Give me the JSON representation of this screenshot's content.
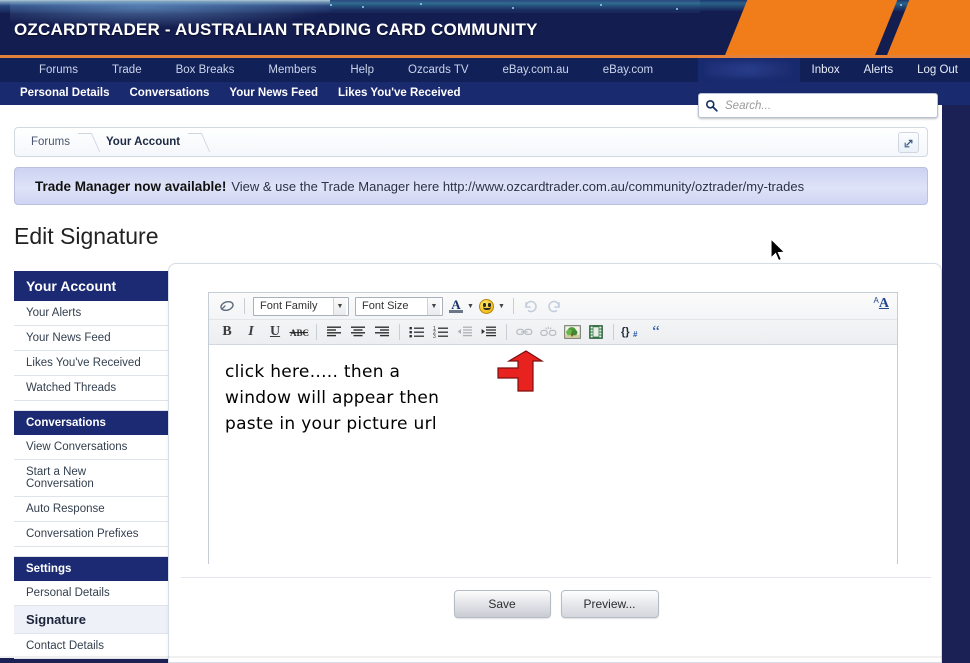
{
  "banner": {
    "title": "OZCARDTRADER - AUSTRALIAN TRADING CARD COMMUNITY"
  },
  "colors": {
    "banner_bg": "#141d4f",
    "accent_orange": "#f07d1a",
    "nav_bg": "#122058",
    "subnav_bg": "#1a2a6f",
    "sidebar_head": "#1b2a72",
    "arrow_red": "#e8231f"
  },
  "mainnav": {
    "items": [
      {
        "label": "Forums"
      },
      {
        "label": "Trade"
      },
      {
        "label": "Box Breaks"
      },
      {
        "label": "Members"
      },
      {
        "label": "Help"
      },
      {
        "label": "Ozcards TV"
      },
      {
        "label": "eBay.com.au"
      },
      {
        "label": "eBay.com"
      }
    ],
    "user_tab_label": "",
    "right_items": [
      {
        "label": "Inbox"
      },
      {
        "label": "Alerts"
      },
      {
        "label": "Log Out"
      }
    ]
  },
  "subnav": {
    "items": [
      {
        "label": "Personal Details"
      },
      {
        "label": "Conversations"
      },
      {
        "label": "Your News Feed"
      },
      {
        "label": "Likes You've Received"
      }
    ]
  },
  "search": {
    "placeholder": "Search...",
    "value": "",
    "icon": "search-icon"
  },
  "breadcrumb": {
    "items": [
      {
        "label": "Forums"
      },
      {
        "label": "Your Account"
      }
    ],
    "expand_icon": "open-in-new-icon"
  },
  "notice": {
    "strong": "Trade Manager now available!",
    "text": "View & use the Trade Manager here http://www.ozcardtrader.com.au/community/oztrader/my-trades"
  },
  "page": {
    "heading": "Edit Signature"
  },
  "sidebar": {
    "sections": [
      {
        "title": "Your Account",
        "style": "main",
        "items": [
          {
            "label": "Your Alerts",
            "active": false
          },
          {
            "label": "Your News Feed",
            "active": false
          },
          {
            "label": "Likes You've Received",
            "active": false
          },
          {
            "label": "Watched Threads",
            "active": false
          }
        ]
      },
      {
        "title": "Conversations",
        "style": "sub",
        "items": [
          {
            "label": "View Conversations",
            "active": false
          },
          {
            "label": "Start a New Conversation",
            "active": false
          },
          {
            "label": "Auto Response",
            "active": false
          },
          {
            "label": "Conversation Prefixes",
            "active": false
          }
        ]
      },
      {
        "title": "Settings",
        "style": "sub",
        "items": [
          {
            "label": "Personal Details",
            "active": false
          },
          {
            "label": "Signature",
            "active": true
          },
          {
            "label": "Contact Details",
            "active": false
          }
        ]
      }
    ]
  },
  "editor": {
    "toolbar_row1": {
      "eraser_icon": "remove-formatting-icon",
      "font_family": {
        "label": "Font Family",
        "icon": "chevron-down-icon"
      },
      "font_size": {
        "label": "Font Size",
        "icon": "chevron-down-icon"
      },
      "font_color": {
        "icon": "font-color-icon",
        "letter": "A"
      },
      "smiley": {
        "icon": "smiley-icon"
      },
      "undo": {
        "icon": "undo-icon"
      },
      "redo": {
        "icon": "redo-icon"
      },
      "toggle_bbcode": {
        "icon": "toggle-bbcode-icon",
        "sup": "A",
        "main": "A"
      }
    },
    "toolbar_row2": [
      {
        "icon": "bold-icon",
        "glyph": "B",
        "disabled": false
      },
      {
        "icon": "italic-icon",
        "glyph": "I",
        "disabled": false
      },
      {
        "icon": "underline-icon",
        "glyph": "U",
        "disabled": false
      },
      {
        "icon": "strikethrough-icon",
        "glyph": "ABC",
        "disabled": false
      },
      {
        "icon": "align-left-icon",
        "glyph": "",
        "disabled": false
      },
      {
        "icon": "align-center-icon",
        "glyph": "",
        "disabled": false
      },
      {
        "icon": "align-right-icon",
        "glyph": "",
        "disabled": false
      },
      {
        "icon": "bullet-list-icon",
        "glyph": "",
        "disabled": false
      },
      {
        "icon": "numbered-list-icon",
        "glyph": "",
        "disabled": false
      },
      {
        "icon": "outdent-icon",
        "glyph": "",
        "disabled": true
      },
      {
        "icon": "indent-icon",
        "glyph": "",
        "disabled": false
      },
      {
        "icon": "link-icon",
        "glyph": "",
        "disabled": true
      },
      {
        "icon": "unlink-icon",
        "glyph": "",
        "disabled": true
      },
      {
        "icon": "insert-image-icon",
        "glyph": "",
        "disabled": false
      },
      {
        "icon": "insert-media-icon",
        "glyph": "",
        "disabled": false
      },
      {
        "icon": "code-icon",
        "glyph": "{}#",
        "disabled": false
      },
      {
        "icon": "quote-icon",
        "glyph": "“",
        "disabled": false
      }
    ],
    "content": "click here..... then a\nwindow will appear then\npaste in your picture url",
    "annotation_arrow": "red-up-arrow-annotation"
  },
  "buttons": {
    "save": "Save",
    "preview": "Preview..."
  },
  "cursor": {
    "icon": "mouse-pointer"
  }
}
